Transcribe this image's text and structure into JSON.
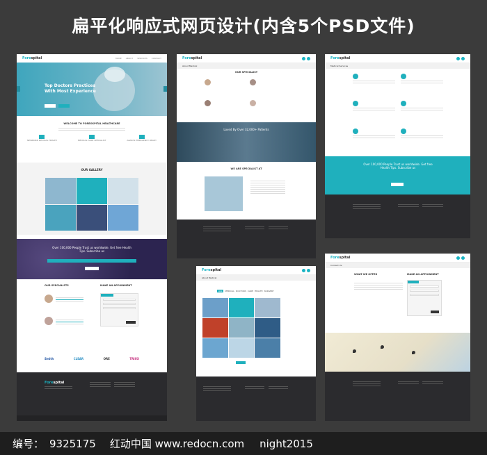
{
  "banner": {
    "title": "扁平化响应式网页设计(内含5个PSD文件)"
  },
  "footer": {
    "id_label": "编号：",
    "id_value": "9325175",
    "site": "红动中国 www.redocn.com",
    "author": "night2015"
  },
  "logo": {
    "brand1": "Fore",
    "brand2": "spital"
  },
  "nav": {
    "items": [
      "HOME",
      "ABOUT",
      "SERVICES",
      "CONTACT"
    ]
  },
  "page1": {
    "hero_title": "Top Doctors Practices",
    "hero_title2": "With Most Experience",
    "welcome": "WELCOME TO FOREOSPITAL HEALTHCARE",
    "features": [
      "NEWBORN MEDICAL HEALTH",
      "MEDICAL CARE SPECIALIST",
      "ALWAYS EMERGENCY READY"
    ],
    "gallery": "OUR GALLERY",
    "trust": "Over  100,000 People Trust us worldwide. Get free Health Tips. Subscribe us",
    "specialists": "OUR SPECIALISTS",
    "appointment": "MAKE AN APPOINMENT",
    "logos": [
      "Smith",
      "CLEAR",
      "ORE",
      "TRIUX"
    ]
  },
  "page2": {
    "sub": "About Medical",
    "specialist": "OUR SPECIALIST",
    "banner": "Loved By Over 32,000+ Patients",
    "we_are": "WE ARE SPECIALIST AT"
  },
  "page3": {
    "sub": "Medical Services",
    "trust": "Over  100,000 People Trust us worldwide. Get free Health Tips. Subscribe us"
  },
  "page4": {
    "sub": "About Medical",
    "tabs": [
      "ALL",
      "MEDICAL",
      "DOCTORS",
      "CARE",
      "HEALTH",
      "SURGERY"
    ]
  },
  "page5": {
    "sub": "Contact Us",
    "offer": "WHAT WE OFFER",
    "appointment": "MAKE AN APPOINMENT"
  }
}
